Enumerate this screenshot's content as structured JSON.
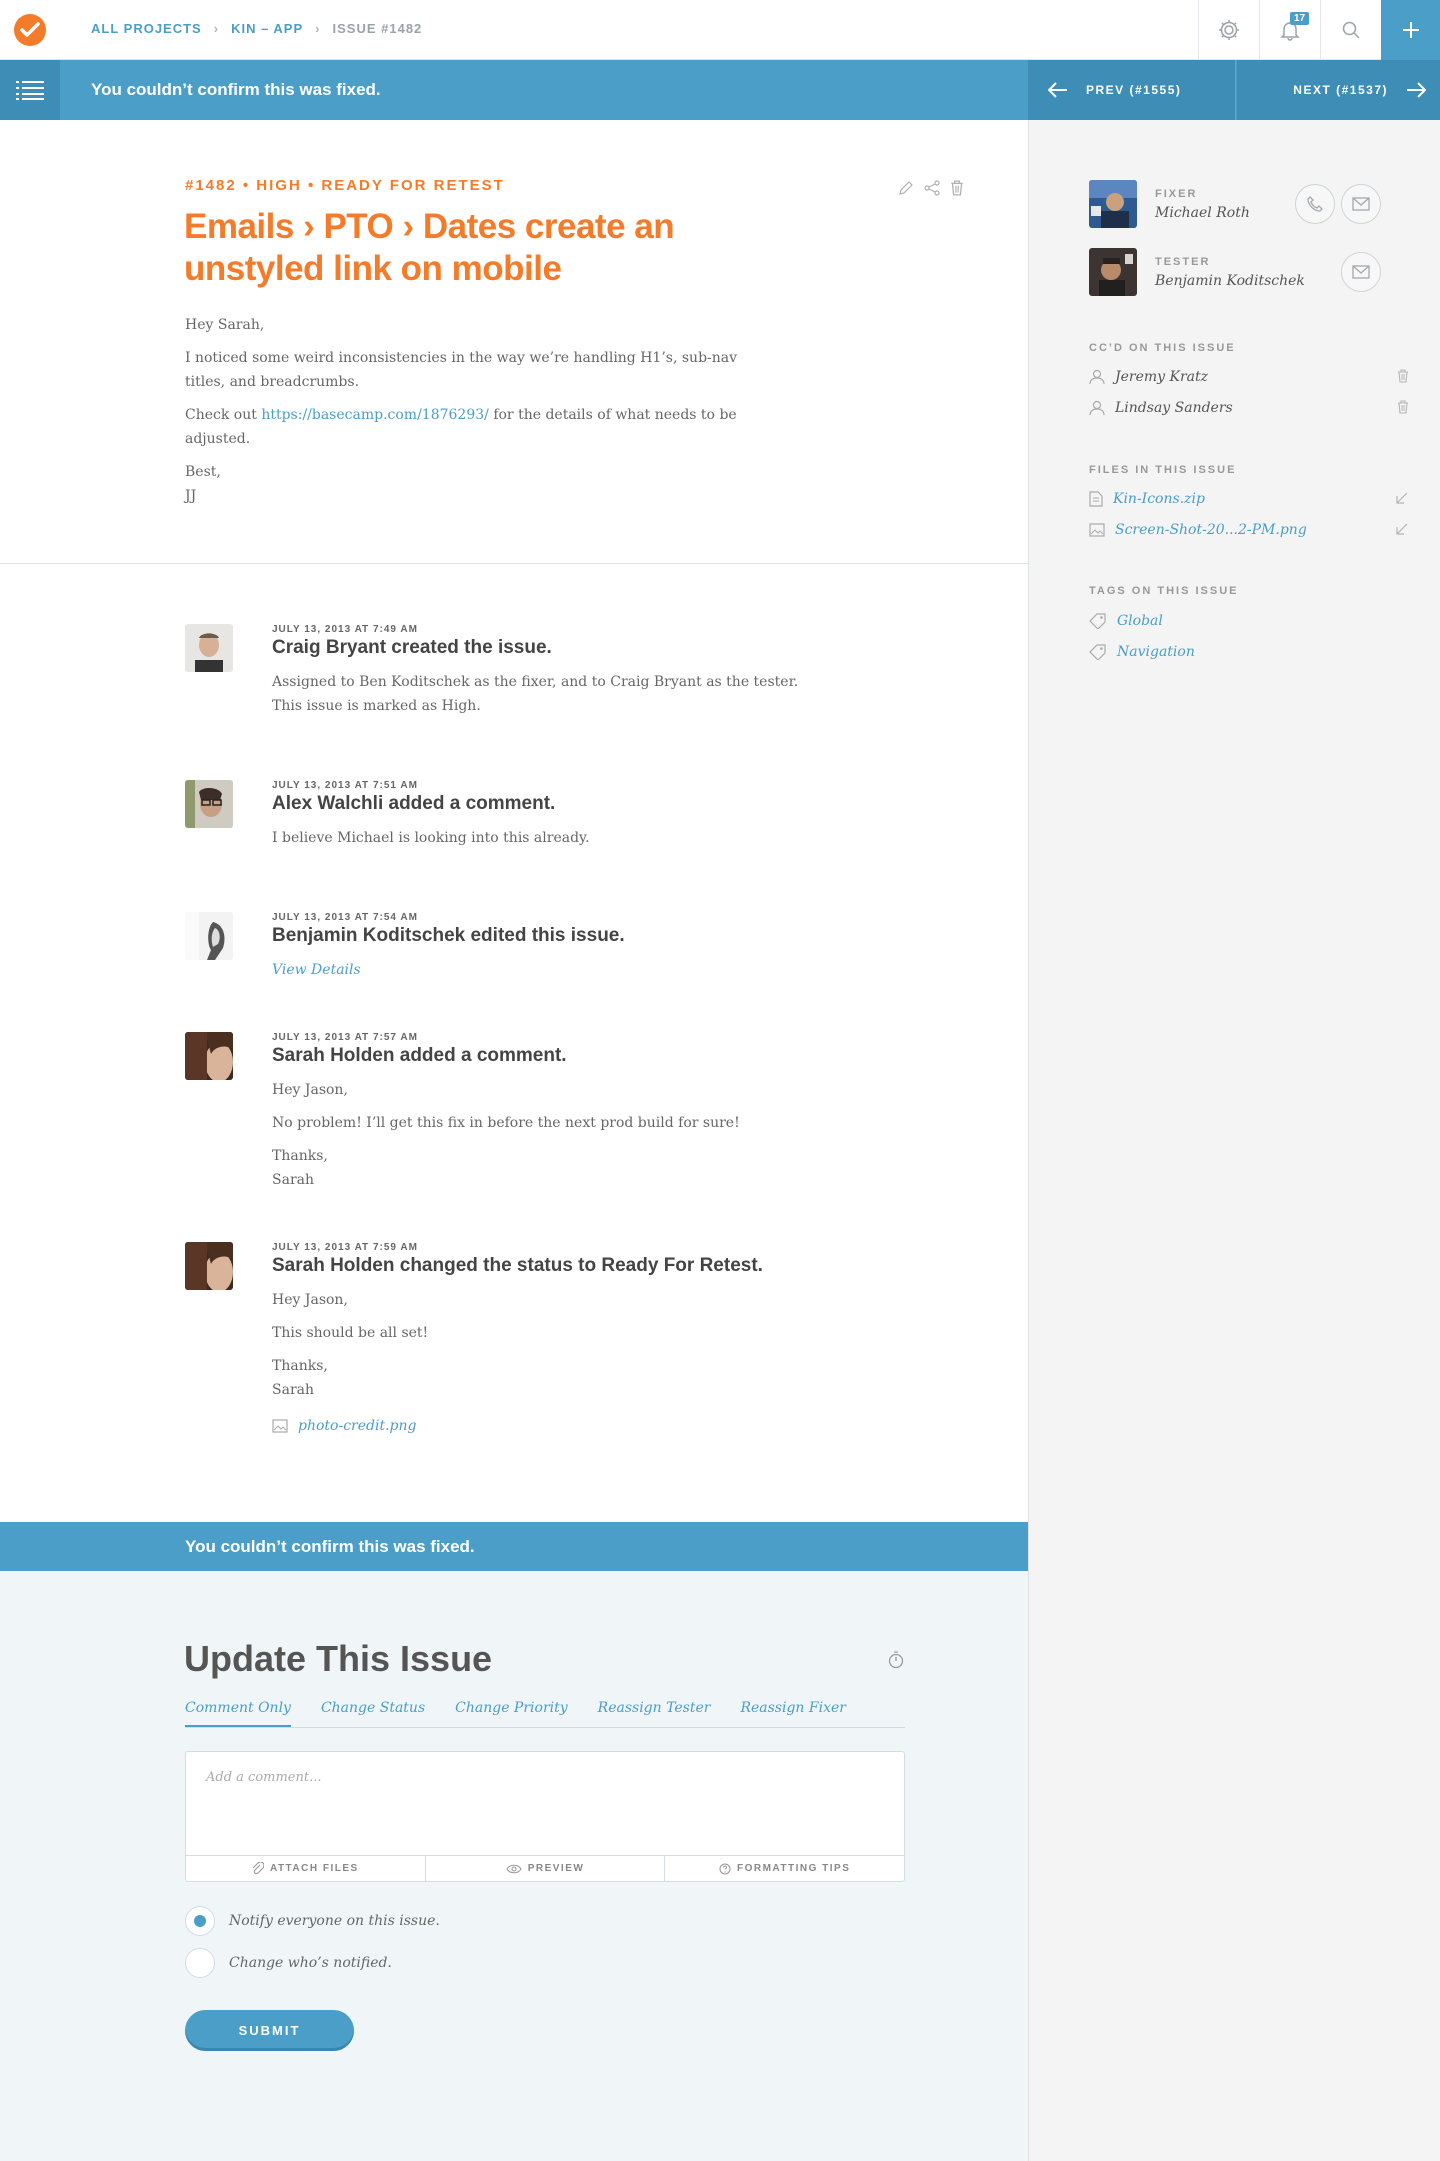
{
  "breadcrumb": {
    "items": [
      "ALL PROJECTS",
      "KIN – APP",
      "ISSUE #1482"
    ],
    "separator": "›"
  },
  "topbar": {
    "notification_count": "17"
  },
  "banner": {
    "status_text": "You couldn’t confirm this was fixed.",
    "prev_label": "PREV (#1555)",
    "next_label": "NEXT (#1537)"
  },
  "issue": {
    "meta": "#1482 • HIGH • READY FOR RETEST",
    "title": "Emails › PTO › Dates create an unstyled link on mobile",
    "greeting": "Hey Sarah,",
    "para1": "I noticed some weird inconsistencies in the way we’re handling H1’s, sub-nav titles, and breadcrumbs.",
    "para2_before": "Check out ",
    "para2_link": "https://basecamp.com/1876293/",
    "para2_after": " for the details of what needs to be adjusted.",
    "signoff": "Best,",
    "signature": "JJ"
  },
  "sidebar": {
    "fixer": {
      "role": "FIXER",
      "name": "Michael Roth"
    },
    "tester": {
      "role": "TESTER",
      "name": "Benjamin Koditschek"
    },
    "cc_heading": "CC’D ON THIS ISSUE",
    "cc": [
      "Jeremy Kratz",
      "Lindsay Sanders"
    ],
    "files_heading": "FILES IN THIS ISSUE",
    "files": [
      "Kin-Icons.zip",
      "Screen-Shot-20...2-PM.png"
    ],
    "tags_heading": "TAGS ON THIS ISSUE",
    "tags": [
      "Global",
      "Navigation"
    ]
  },
  "activity": [
    {
      "date": "JULY 13, 2013 AT 7:49 AM",
      "headline": "Craig Bryant created the issue.",
      "lines": [
        "Assigned to Ben Koditschek as the fixer, and to Craig Bryant as the tester. This issue is marked as High."
      ]
    },
    {
      "date": "JULY 13, 2013 AT 7:51 AM",
      "headline": "Alex Walchli added a comment.",
      "lines": [
        "I believe Michael is looking into this already."
      ]
    },
    {
      "date": "JULY 13, 2013 AT 7:54 AM",
      "headline": "Benjamin Koditschek edited this issue.",
      "link": "View Details"
    },
    {
      "date": "JULY 13, 2013 AT 7:57 AM",
      "headline": "Sarah Holden added a comment.",
      "lines": [
        "Hey Jason,",
        "No problem! I’ll get this fix in before the next prod build for sure!",
        "Thanks,",
        "Sarah"
      ]
    },
    {
      "date": "JULY 13, 2013 AT 7:59 AM",
      "headline": "Sarah Holden changed the status to Ready For Retest.",
      "lines": [
        "Hey Jason,",
        "This should be all set!",
        "Thanks,",
        "Sarah"
      ],
      "attachment": "photo-credit.png"
    }
  ],
  "bottom_banner": "You couldn’t confirm this was fixed.",
  "update_form": {
    "title": "Update This Issue",
    "tabs": [
      "Comment Only",
      "Change Status",
      "Change Priority",
      "Reassign Tester",
      "Reassign Fixer"
    ],
    "placeholder": "Add a comment...",
    "footer": [
      "ATTACH FILES",
      "PREVIEW",
      "FORMATTING TIPS"
    ],
    "notify_options": [
      "Notify everyone on this issue.",
      "Change who’s notified."
    ],
    "submit": "SUBMIT"
  },
  "colors": {
    "accent_blue": "#4a9ec7",
    "accent_orange": "#f47b2a",
    "sidebar_bg": "#f4f4f4",
    "form_bg": "#f0f5f8"
  }
}
